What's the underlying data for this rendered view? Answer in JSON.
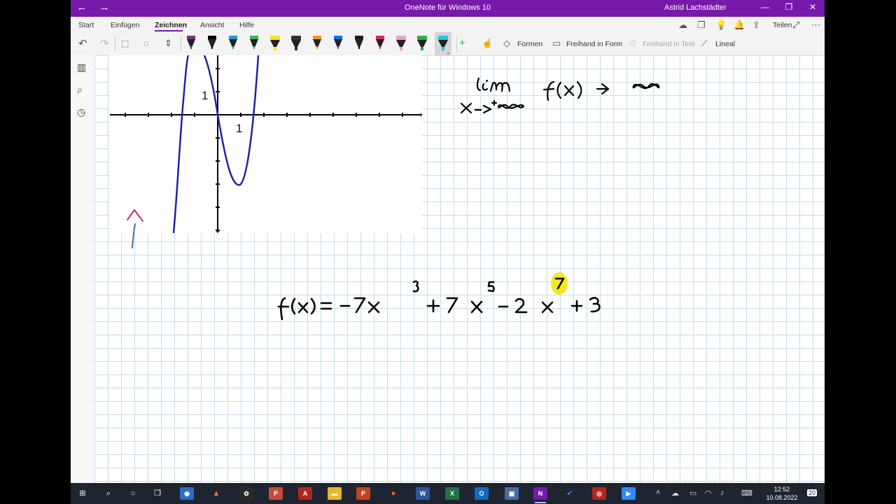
{
  "window": {
    "title": "OneNote für Windows 10",
    "user": "Astrid Lachstädter",
    "back_glyph": "←",
    "forward_glyph": "→",
    "minimize_glyph": "—",
    "maximize_glyph": "❐",
    "close_glyph": "✕"
  },
  "ribbon": {
    "tabs": [
      "Start",
      "Einfügen",
      "Zeichnen",
      "Ansicht",
      "Hilfe"
    ],
    "active_tab": "Zeichnen",
    "share_label": "Teilen",
    "accent_color": "#7719aa"
  },
  "toolbar": {
    "pen_colors": [
      "#7b2d8f",
      "#000000",
      "#1f9bd4",
      "#3db34a",
      "#f3e81a",
      "#333333",
      "#f29a1b",
      "#1e6fd8",
      "#1a1a1a",
      "#d6246e",
      "#e8a0c8",
      "#2fae4e",
      "#27c6d9"
    ],
    "shapes_label": "Formen",
    "ink_to_shape_label": "Freihand in Form",
    "ink_to_text_label": "Freihand in Text",
    "ruler_label": "Lineal"
  },
  "page": {
    "graph_tick_label_y": "1",
    "graph_tick_label_x": "1",
    "limit_handwriting": "lim x→+∞ f(x) → ∞",
    "function_handwriting": "f(x) = -7x³ + 7x⁵ - 2x⁷ + 3"
  },
  "taskbar": {
    "time": "12:52",
    "date": "10.08.2022",
    "notification_count": "20",
    "apps": [
      "windows-start",
      "search",
      "cortana",
      "task-view",
      "camera",
      "vlc",
      "settings",
      "powerpoint-viewer",
      "acrobat",
      "explorer",
      "powerpoint",
      "firefox",
      "word",
      "excel",
      "outlook",
      "media",
      "onenote",
      "todo",
      "geogebra",
      "zoom"
    ]
  }
}
